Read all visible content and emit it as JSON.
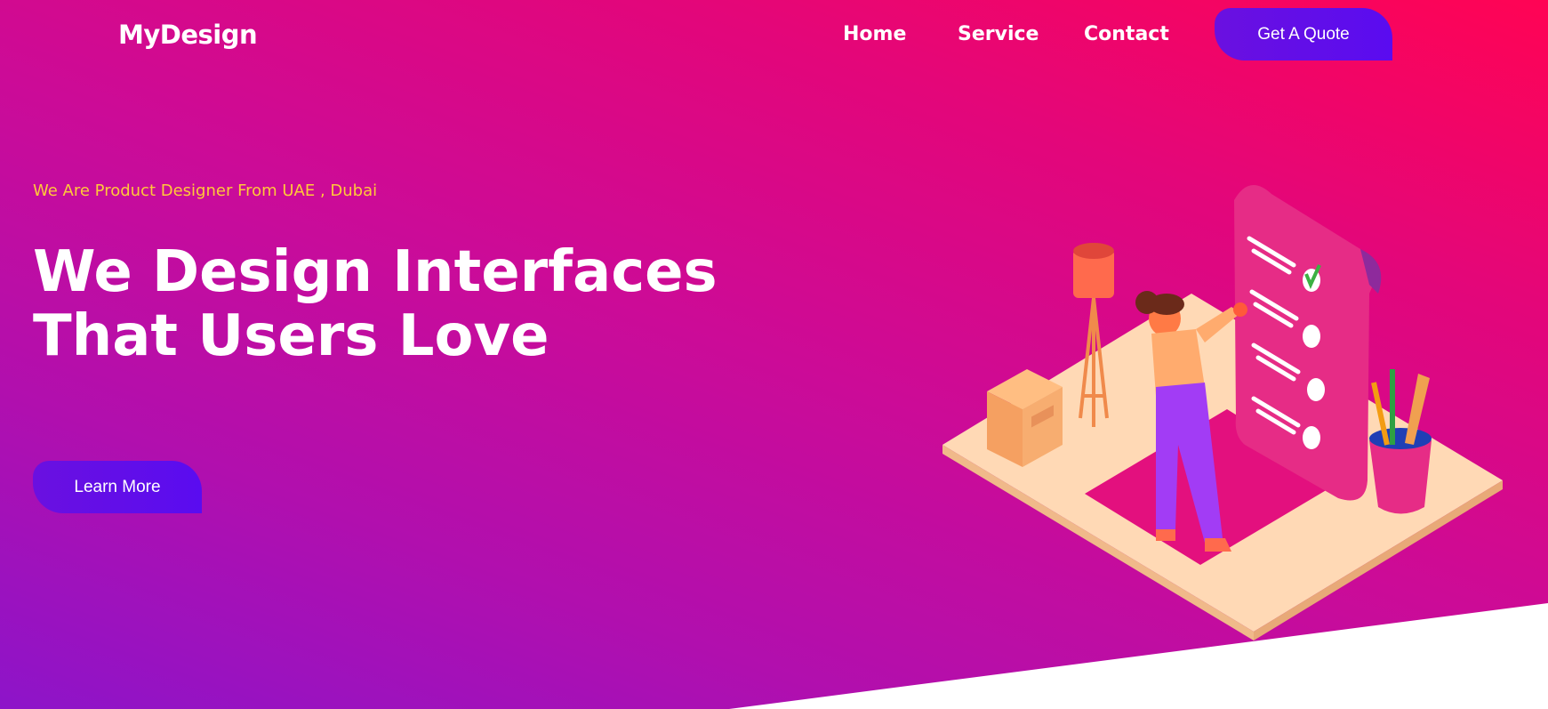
{
  "header": {
    "logo": "MyDesign",
    "nav": [
      {
        "label": "Home"
      },
      {
        "label": "Service"
      },
      {
        "label": "Contact"
      }
    ],
    "cta_label": "Get A Quote"
  },
  "hero": {
    "tagline": "We Are Product Designer From UAE , Dubai",
    "headline": "We Design Interfaces That Users Love",
    "button_label": "Learn More"
  },
  "colors": {
    "gradient_start": "#8d14c9",
    "gradient_end": "#ff0454",
    "button": "#5a0cf0",
    "tagline": "#ffc93a",
    "text": "#ffffff"
  },
  "illustration": {
    "icon": "designer-checklist-illustration"
  }
}
